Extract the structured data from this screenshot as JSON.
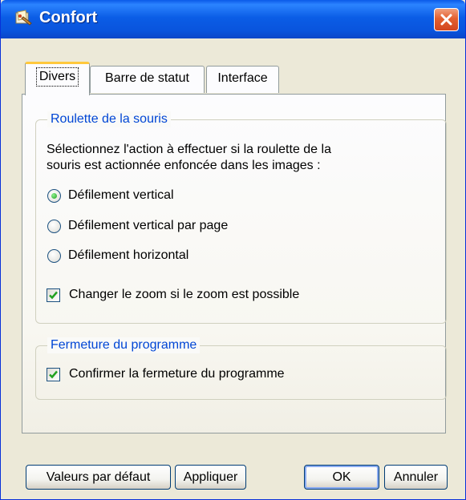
{
  "window": {
    "title": "Confort",
    "icon": "app-icon",
    "close_icon": "close-icon"
  },
  "tabs": [
    {
      "label": "Divers",
      "active": true
    },
    {
      "label": "Barre de statut",
      "active": false
    },
    {
      "label": "Interface",
      "active": false
    }
  ],
  "groups": {
    "mouse_wheel": {
      "legend": "Roulette de la souris",
      "description_line1": "Sélectionnez l'action à effectuer si la roulette de la",
      "description_line2": "souris est actionnée enfoncée dans les images :",
      "options": [
        {
          "label": "Défilement vertical",
          "selected": true
        },
        {
          "label": "Défilement vertical par page",
          "selected": false
        },
        {
          "label": "Défilement horizontal",
          "selected": false
        }
      ],
      "zoom_checkbox": {
        "label": "Changer le zoom si le zoom est possible",
        "checked": true
      }
    },
    "program_close": {
      "legend": "Fermeture du programme",
      "confirm_checkbox": {
        "label": "Confirmer la fermeture du programme",
        "checked": true
      }
    }
  },
  "buttons": {
    "defaults": "Valeurs par défaut",
    "apply": "Appliquer",
    "ok": "OK",
    "cancel": "Annuler"
  },
  "colors": {
    "titlebar": "#0a5ae8",
    "legend": "#0046d5",
    "tab_highlight": "#ffc83c",
    "check": "#21a121"
  }
}
